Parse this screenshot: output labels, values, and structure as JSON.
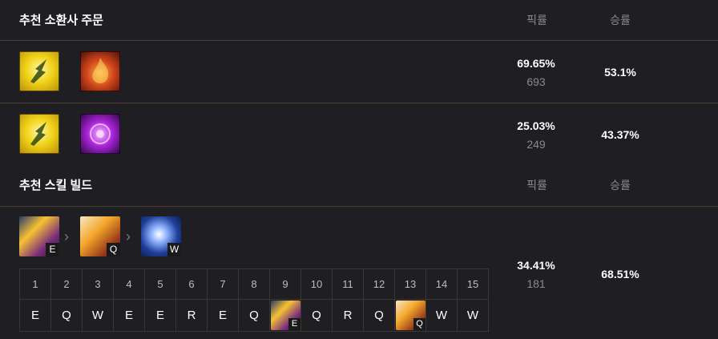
{
  "summoner_section": {
    "title": "추천 소환사 주문",
    "pick_label": "픽률",
    "win_label": "승률",
    "rows": [
      {
        "spells": [
          "flash-icon",
          "ignite-icon"
        ],
        "pick_rate": "69.65%",
        "count": "693",
        "win_rate": "53.1%"
      },
      {
        "spells": [
          "flash-icon",
          "exhaust-icon"
        ],
        "pick_rate": "25.03%",
        "count": "249",
        "win_rate": "43.37%"
      }
    ]
  },
  "skill_section": {
    "title": "추천 스킬 빌드",
    "pick_label": "픽률",
    "win_label": "승률",
    "order": [
      {
        "key": "E",
        "icon": "skill-e-icon"
      },
      {
        "key": "Q",
        "icon": "skill-q-icon"
      },
      {
        "key": "W",
        "icon": "skill-w-icon"
      }
    ],
    "levels": [
      "1",
      "2",
      "3",
      "4",
      "5",
      "6",
      "7",
      "8",
      "9",
      "10",
      "11",
      "12",
      "13",
      "14",
      "15"
    ],
    "keys": [
      "E",
      "Q",
      "W",
      "E",
      "E",
      "R",
      "E",
      "Q",
      "E",
      "Q",
      "R",
      "Q",
      "Q",
      "W",
      "W"
    ],
    "pick_rate": "34.41%",
    "count": "181",
    "win_rate": "68.51%"
  },
  "colors": {
    "background": "#1f1f23",
    "separator": "#4a3f2f",
    "muted_text": "#8a8a8a"
  }
}
